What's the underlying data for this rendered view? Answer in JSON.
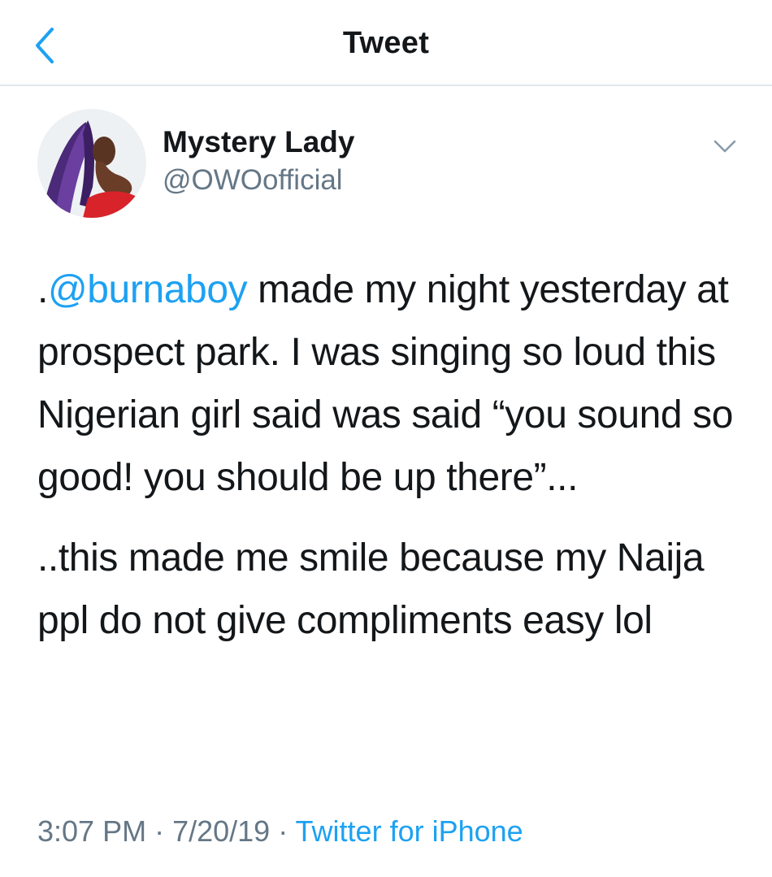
{
  "header": {
    "title": "Tweet",
    "back_icon": "chevron-left-icon"
  },
  "author": {
    "name": "Mystery Lady",
    "handle": "@OWOofficial",
    "avatar_icon": "profile-photo"
  },
  "tweet": {
    "p1_prefix": ".",
    "p1_mention": "@burnaboy",
    "p1_rest": " made my night yesterday at prospect park. I was singing so loud this Nigerian girl said was said “you sound so good! you should be up there”...",
    "p2": "..this made me smile because my Naija ppl do not give compliments easy lol"
  },
  "meta": {
    "time": "3:07 PM",
    "sep1": " · ",
    "date": "7/20/19",
    "sep2": " · ",
    "source": "Twitter for iPhone"
  },
  "colors": {
    "accent": "#1da1f2",
    "secondary_text": "#657786",
    "primary_text": "#14171a",
    "divider": "#e1e8ed"
  }
}
